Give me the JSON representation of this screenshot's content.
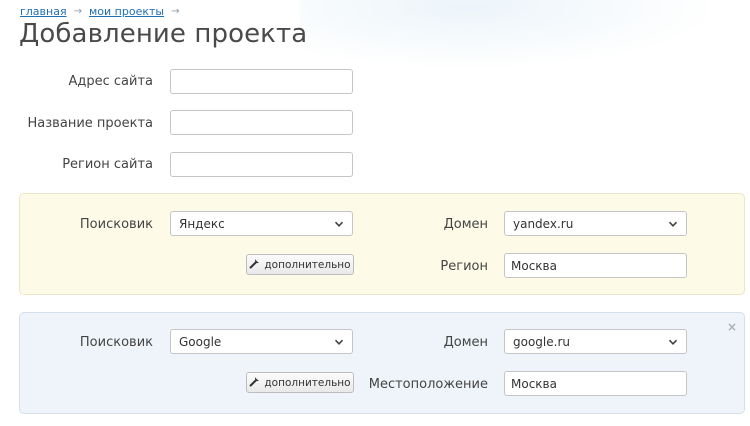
{
  "breadcrumb": {
    "items": [
      "главная",
      "мои проекты"
    ]
  },
  "page": {
    "title": "Добавление проекта"
  },
  "form": {
    "site_address_label": "Адрес сайта",
    "site_address_value": "",
    "project_name_label": "Название проекта",
    "project_name_value": "",
    "site_region_label": "Регион сайта",
    "site_region_value": ""
  },
  "engines": [
    {
      "engine_label": "Поисковик",
      "engine_value": "Яндекс",
      "domain_label": "Домен",
      "domain_value": "yandex.ru",
      "extra_button": "дополнительно",
      "region_label": "Регион",
      "region_value": "Москва"
    },
    {
      "engine_label": "Поисковик",
      "engine_value": "Google",
      "domain_label": "Домен",
      "domain_value": "google.ru",
      "extra_button": "дополнительно",
      "region_label": "Местоположение",
      "region_value": "Москва",
      "close_icon": "×"
    }
  ],
  "colors": {
    "link": "#1f6fb3",
    "panel_yandex": "#fdfbe8",
    "panel_google": "#eef4fa"
  },
  "icons": [
    "wrench-icon",
    "chevron-down-icon",
    "close-icon",
    "arrow-right-icon"
  ]
}
